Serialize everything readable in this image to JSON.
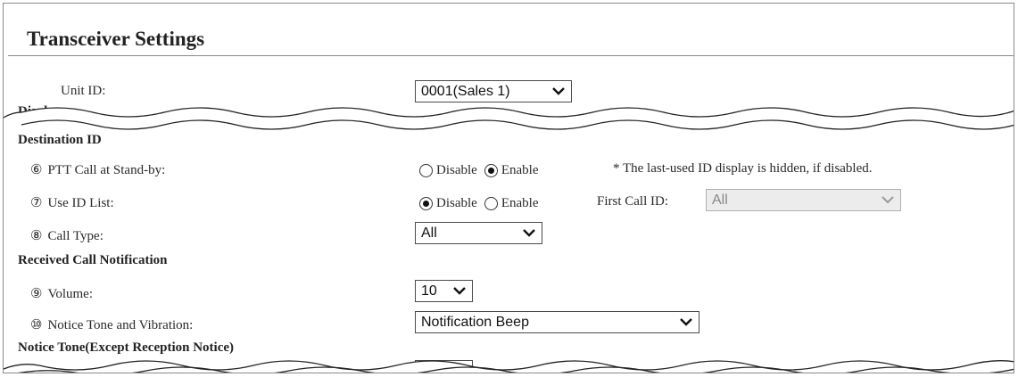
{
  "page": {
    "title": "Transceiver Settings"
  },
  "unit_id": {
    "label": "Unit ID:",
    "value": "0001(Sales 1)"
  },
  "cut_text": "Displa",
  "destination_id": {
    "heading": "Destination ID",
    "ptt_call": {
      "number": "⑥",
      "label": "PTT Call at Stand-by:",
      "options": [
        "Disable",
        "Enable"
      ],
      "selected": "Enable",
      "note": "* The last-used ID display is hidden, if disabled."
    },
    "use_id_list": {
      "number": "⑦",
      "label": "Use ID List:",
      "options": [
        "Disable",
        "Enable"
      ],
      "selected": "Disable",
      "first_call_label": "First Call ID:",
      "first_call_value": "All"
    },
    "call_type": {
      "number": "⑧",
      "label": "Call Type:",
      "value": "All"
    }
  },
  "received_call": {
    "heading": "Received Call Notification",
    "volume": {
      "number": "⑨",
      "label": "Volume:",
      "value": "10"
    },
    "notice_tone": {
      "number": "⑩",
      "label": "Notice Tone and Vibration:",
      "value": "Notification Beep"
    }
  },
  "notice_tone_except": {
    "heading": "Notice Tone(Except Reception Notice)"
  },
  "icons": {
    "dropdown": "chevron-down-icon",
    "break": "wavy-break-line"
  }
}
